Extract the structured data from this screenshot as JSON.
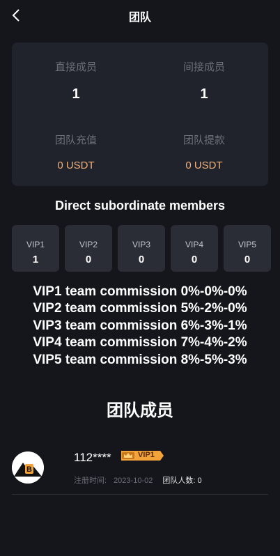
{
  "header": {
    "title": "团队"
  },
  "stats": {
    "direct_label": "直接成员",
    "direct_value": "1",
    "indirect_label": "间接成员",
    "indirect_value": "1",
    "recharge_label": "团队充值",
    "recharge_value": "0 USDT",
    "withdraw_label": "团队提款",
    "withdraw_value": "0 USDT"
  },
  "subordinates": {
    "heading": "Direct subordinate members",
    "levels": [
      {
        "name": "VIP1",
        "count": "1"
      },
      {
        "name": "VIP2",
        "count": "0"
      },
      {
        "name": "VIP3",
        "count": "0"
      },
      {
        "name": "VIP4",
        "count": "0"
      },
      {
        "name": "VIP5",
        "count": "0"
      }
    ]
  },
  "commissions": [
    "VIP1 team commission 0%-0%-0%",
    "VIP2 team commission 5%-2%-0%",
    "VIP3 team commission 6%-3%-1%",
    "VIP4 team commission 7%-4%-2%",
    "VIP5 team commission 8%-5%-3%"
  ],
  "members": {
    "title": "团队成员",
    "list": [
      {
        "username": "112****",
        "vip": "VIP1",
        "reg_label": "注册时间:",
        "reg_date": "2023-10-02",
        "team_label": "团队人数: 0"
      }
    ]
  },
  "colors": {
    "background": "#14161c",
    "card": "#20232b",
    "vip_box": "#2a2d35",
    "money": "#f3b078",
    "muted": "#6b6f78",
    "badge": "#f2a33a"
  }
}
